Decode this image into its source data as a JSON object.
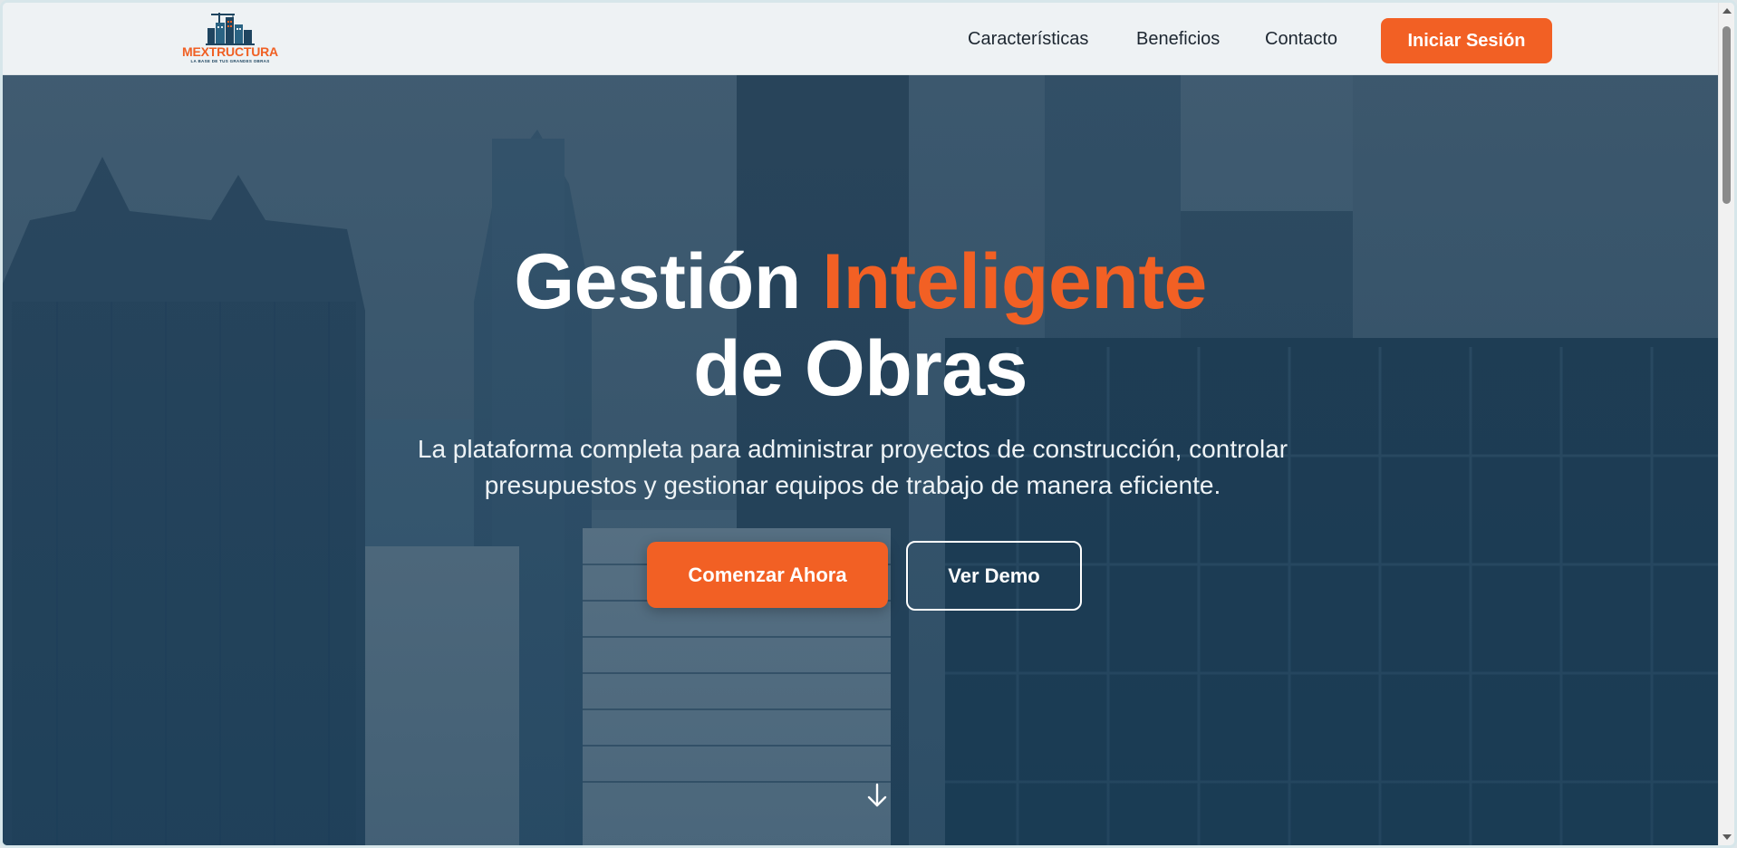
{
  "brand": {
    "name": "MEXTRUCTURA",
    "tagline": "LA BASE DE TUS GRANDES OBRAS",
    "accent_color": "#f26024",
    "dark_color": "#1f4560"
  },
  "nav": {
    "links": [
      {
        "label": "Características"
      },
      {
        "label": "Beneficios"
      },
      {
        "label": "Contacto"
      }
    ],
    "login_label": "Iniciar Sesión"
  },
  "hero": {
    "title_part1": "Gestión ",
    "title_accent": "Inteligente",
    "title_part2": "de Obras",
    "subtitle": "La plataforma completa para administrar proyectos de construcción, controlar presupuestos y gestionar equipos de trabajo de manera eficiente.",
    "primary_cta": "Comenzar Ahora",
    "secondary_cta": "Ver Demo",
    "scroll_icon": "arrow-down-icon"
  }
}
